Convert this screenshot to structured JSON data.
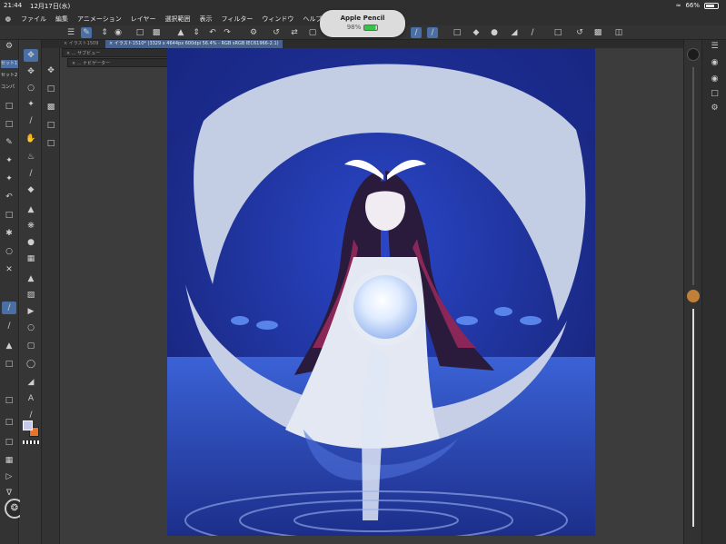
{
  "status_bar": {
    "time": "21:44",
    "date": "12月17日(水)",
    "battery": "66%"
  },
  "menu": [
    "ファイル",
    "編集",
    "アニメーション",
    "レイヤー",
    "選択範囲",
    "表示",
    "フィルター",
    "ウィンドウ",
    "ヘルプ"
  ],
  "pencil_popup": {
    "title": "Apple Pencil",
    "battery": "98%"
  },
  "tabs": [
    {
      "label": "イラスト1509",
      "active": false
    },
    {
      "label": "イラスト1510* (3329 x 4644px 600dpi 56.4%  - RGB sRGB IEC61966-2.1)",
      "active": true
    }
  ],
  "subviews": [
    {
      "label": "サブビュー"
    },
    {
      "label": "ナビゲーター"
    }
  ],
  "subtool_sets": [
    {
      "label": "セット1",
      "active": true
    },
    {
      "label": "セット2",
      "active": false
    },
    {
      "label": "コンパ",
      "active": false
    }
  ],
  "colors": {
    "accent": "#4a6fa5",
    "main_color": "#c8c8e8",
    "sub_color": "#e8742c"
  }
}
